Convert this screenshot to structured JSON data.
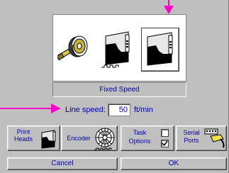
{
  "mode_selector": {
    "modes": [
      {
        "name": "encoder",
        "icon": "encoder-wheel-icon",
        "selected": false
      },
      {
        "name": "print-head-trigger",
        "icon": "print-head-icon",
        "selected": false
      },
      {
        "name": "fixed-speed",
        "icon": "print-head-icon",
        "selected": true
      }
    ],
    "selected_label": "Fixed Speed"
  },
  "line_speed": {
    "label": "Line speed:",
    "value": "50",
    "unit": "ft/min"
  },
  "tabs": {
    "print_heads": {
      "line1": "Print",
      "line2": "Heads",
      "icon": "print-head-icon"
    },
    "encoder": {
      "label": "Encoder",
      "icon": "encoder-wheel-icon"
    },
    "task_options": {
      "line1": "Task",
      "line2": "Options",
      "checkbox_top": false,
      "checkbox_bottom": true
    },
    "serial_ports": {
      "line1": "Serial",
      "line2": "Ports",
      "icon": "serial-cable-icon"
    }
  },
  "actions": {
    "cancel_label": "Cancel",
    "ok_label": "OK"
  },
  "colors": {
    "panel": "#c0c0c0",
    "text": "#0000b0",
    "callout_arrow": "#ff00cc"
  }
}
